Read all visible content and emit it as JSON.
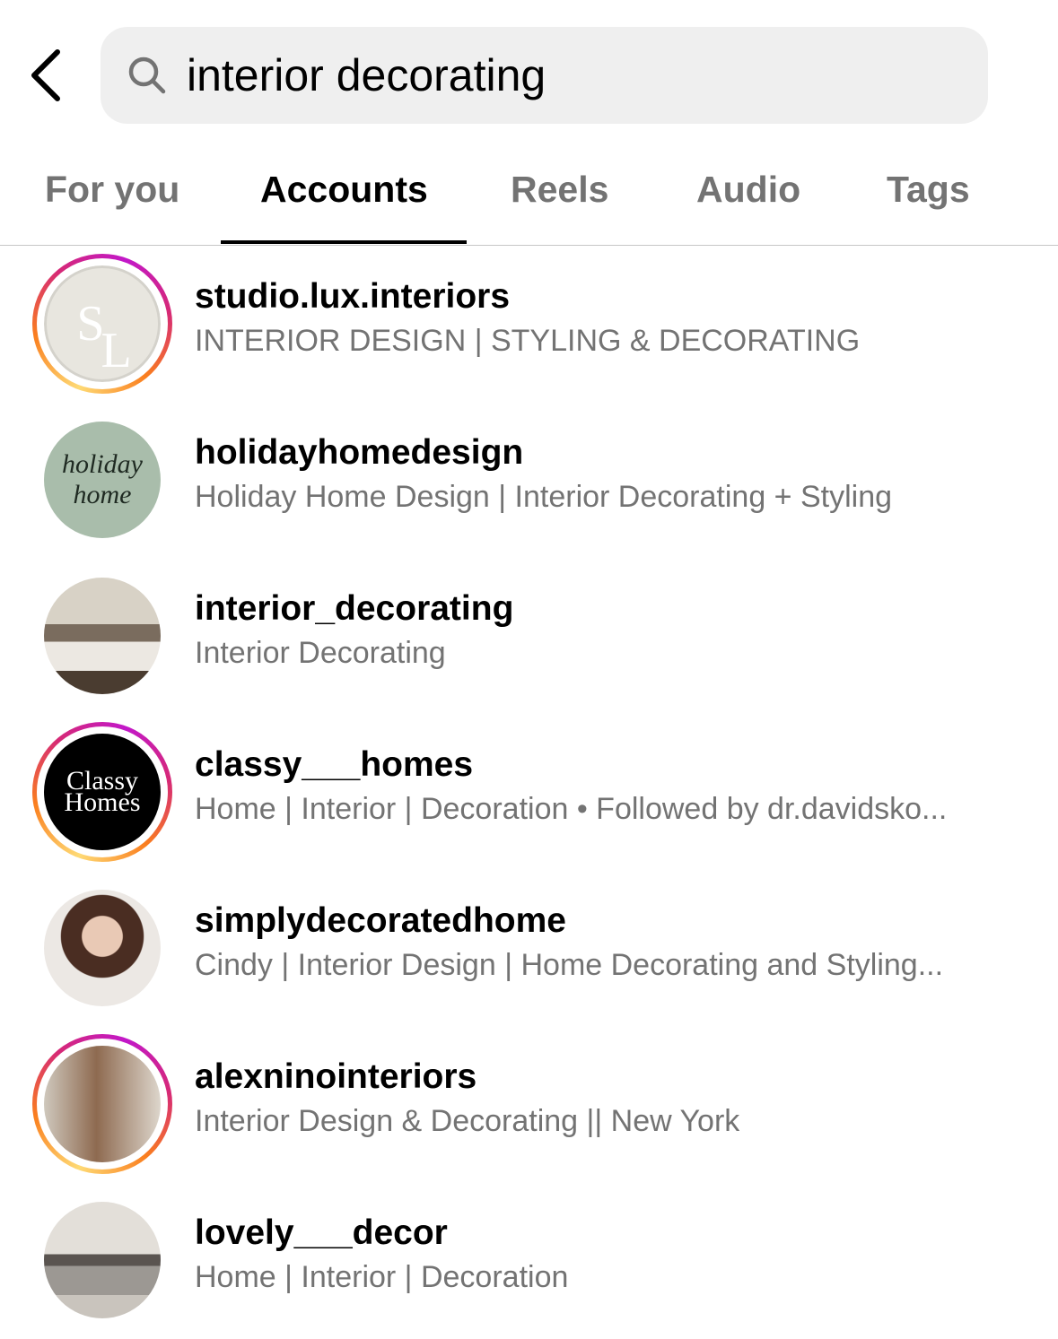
{
  "search": {
    "value": "interior decorating"
  },
  "tabs": [
    {
      "label": "For you"
    },
    {
      "label": "Accounts",
      "active": true
    },
    {
      "label": "Reels"
    },
    {
      "label": "Audio"
    },
    {
      "label": "Tags"
    }
  ],
  "accounts": [
    {
      "username": "studio.lux.interiors",
      "subtitle": "INTERIOR DESIGN | STYLING & DECORATING",
      "story_ring": true,
      "avatar_text": "SL"
    },
    {
      "username": "holidayhomedesign",
      "subtitle": "Holiday Home Design | Interior Decorating + Styling",
      "story_ring": false,
      "avatar_text": "holiday home"
    },
    {
      "username": "interior_decorating",
      "subtitle": "Interior Decorating",
      "story_ring": false
    },
    {
      "username": "classy___homes",
      "subtitle": "Home | Interior | Decoration • Followed by dr.davidsko...",
      "story_ring": true,
      "avatar_text": "Classy Homes"
    },
    {
      "username": "simplydecoratedhome",
      "subtitle": "Cindy | Interior Design | Home Decorating and Styling...",
      "story_ring": false
    },
    {
      "username": "alexninointeriors",
      "subtitle": "Interior Design & Decorating || New York",
      "story_ring": true
    },
    {
      "username": "lovely___decor",
      "subtitle": "Home | Interior | Decoration",
      "story_ring": false
    }
  ]
}
